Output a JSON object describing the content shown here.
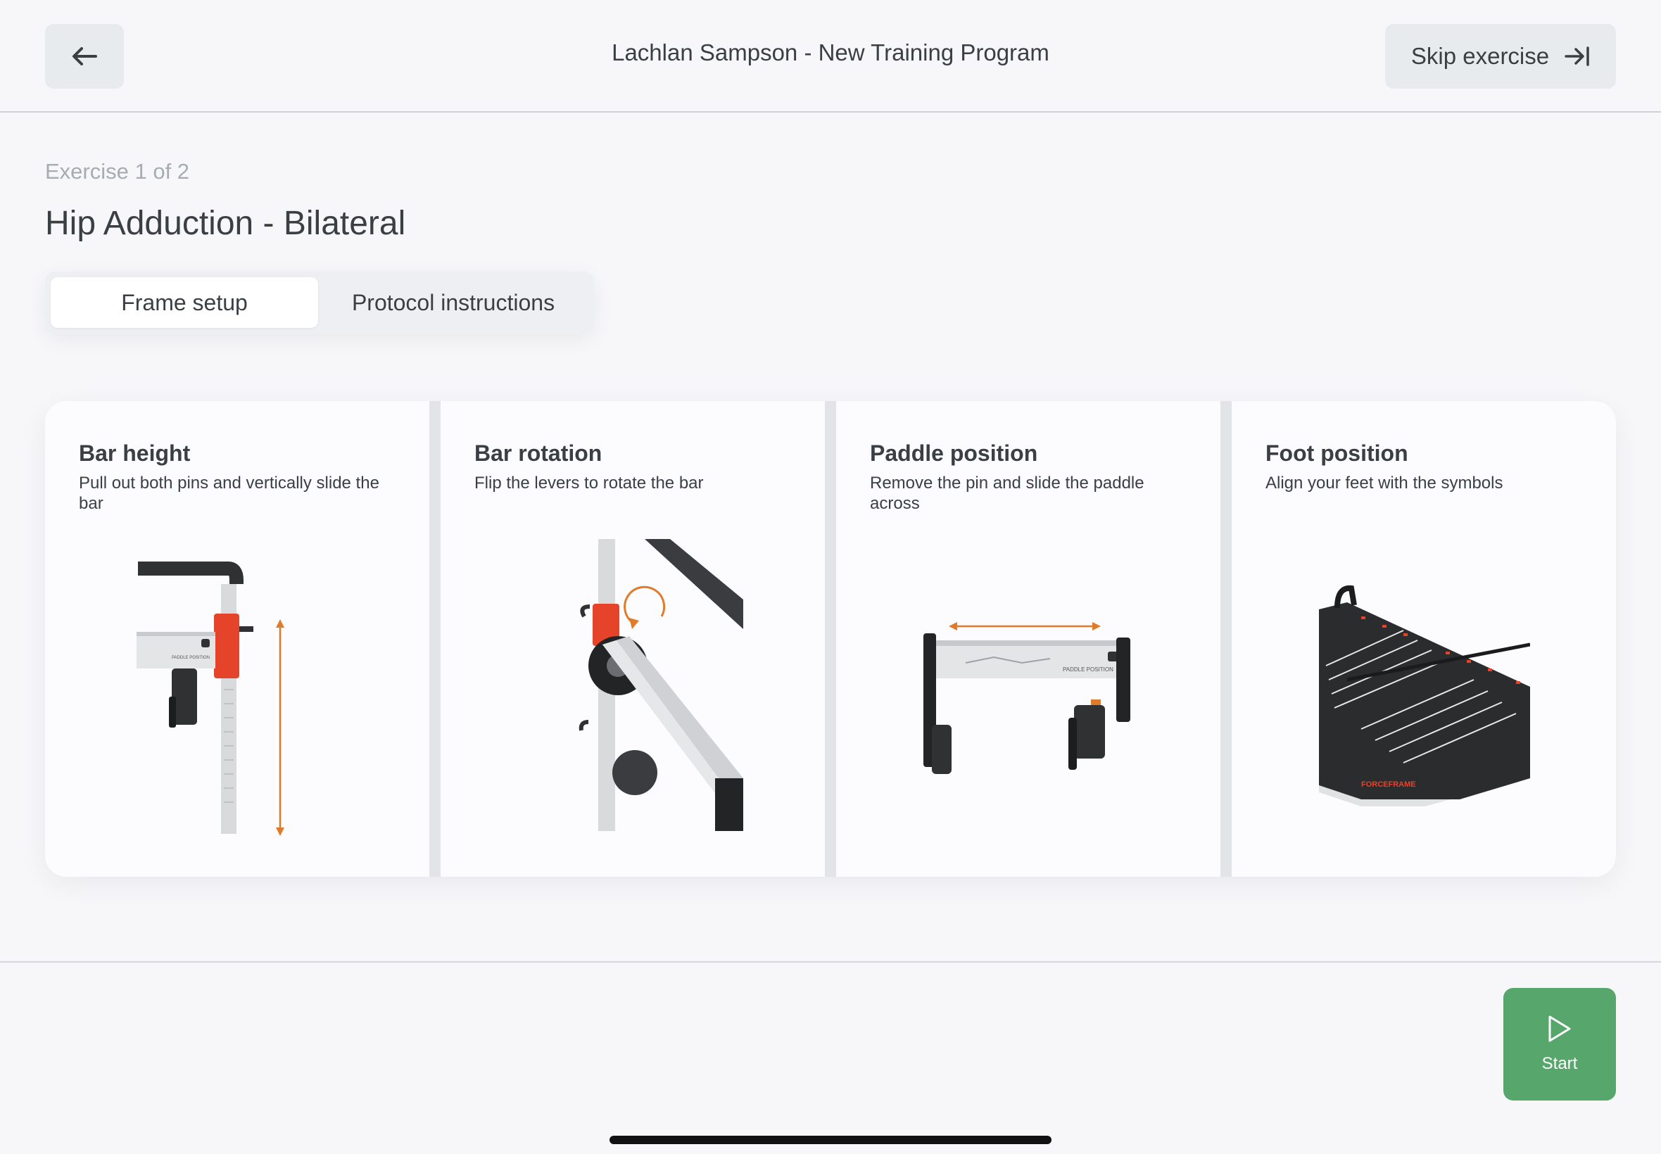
{
  "header": {
    "title": "Lachlan Sampson - New Training Program",
    "back_icon": "arrow-left-icon",
    "skip_label": "Skip exercise",
    "skip_icon": "arrow-right-to-bar-icon"
  },
  "exercise": {
    "counter": "Exercise 1 of 2",
    "title": "Hip Adduction - Bilateral"
  },
  "tabs": [
    {
      "label": "Frame setup",
      "selected": true
    },
    {
      "label": "Protocol instructions",
      "selected": false
    }
  ],
  "cards": [
    {
      "title": "Bar height",
      "description": "Pull out both pins and vertically slide the bar"
    },
    {
      "title": "Bar rotation",
      "description": "Flip the levers to rotate the bar"
    },
    {
      "title": "Paddle position",
      "description": "Remove the pin and slide the paddle across"
    },
    {
      "title": "Foot position",
      "description": "Align your feet with the symbols"
    }
  ],
  "illustration_labels": {
    "paddle_1": "PADDLE POSITION",
    "paddle_2": "PADDLE POSITION",
    "brand": "FORCEFRAME"
  },
  "start": {
    "label": "Start",
    "icon": "play-icon"
  },
  "colors": {
    "accent_orange": "#e07b2c",
    "frame_red": "#e5432a",
    "start_green": "#57a66b"
  }
}
